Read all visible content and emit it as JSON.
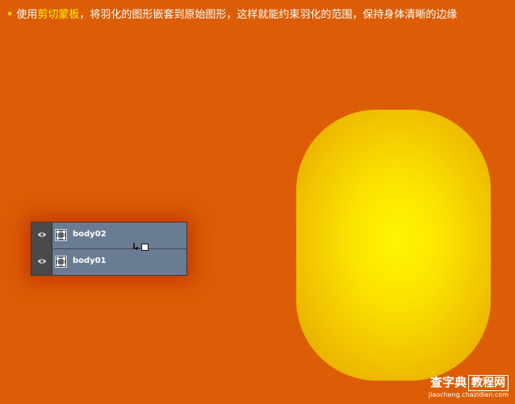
{
  "caption": {
    "bullet": "•",
    "before": "使用",
    "highlight": "剪切蒙板",
    "after": "，将羽化的图形嵌套到原始图形，这样就能约束羽化的范围，保持身体清晰的边缘"
  },
  "layers_panel": {
    "layers": [
      {
        "name": "body02",
        "icon": "eye-icon"
      },
      {
        "name": "body01",
        "icon": "eye-icon"
      }
    ],
    "cursor_icon": "clipping-mask-cursor-icon"
  },
  "watermark": {
    "site": "查字典",
    "section": "教程网",
    "url": "jiaocheng.chazidian.com"
  },
  "colors": {
    "background": "#dc5d05",
    "highlight": "#fff200",
    "capsule_center": "#fff500",
    "capsule_edge": "#eab200",
    "panel": "#6a7c93"
  }
}
